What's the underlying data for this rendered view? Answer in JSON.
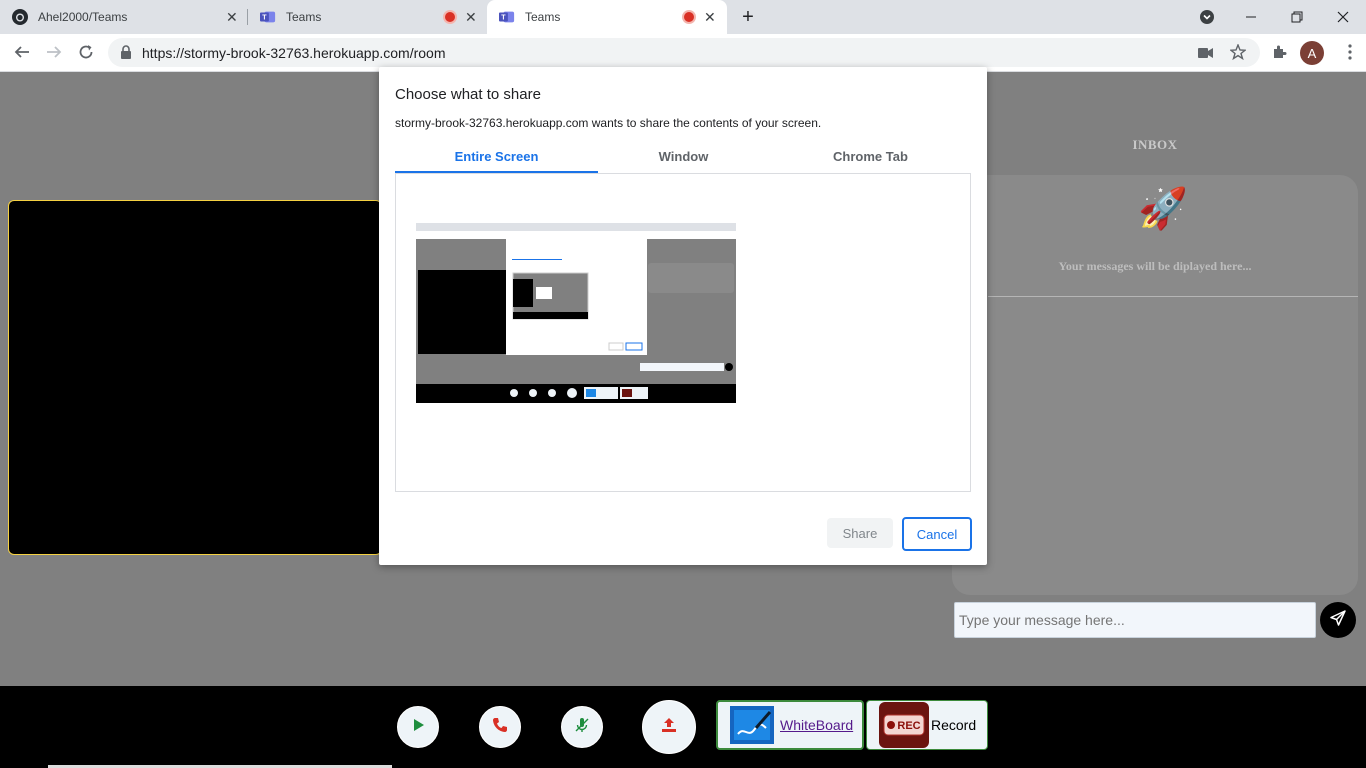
{
  "browser": {
    "tabs": [
      {
        "title": "Ahel2000/Teams",
        "icon": "github-icon"
      },
      {
        "title": "Teams",
        "icon": "teams-icon",
        "recording": true
      },
      {
        "title": "Teams",
        "icon": "teams-icon",
        "recording": true,
        "active": true
      }
    ],
    "url": "https://stormy-brook-32763.herokuapp.com/room",
    "profile_initial": "A"
  },
  "page": {
    "inbox_title": "INBOX",
    "inbox_empty_text": "Your messages will be diplayed here...",
    "message_placeholder": "Type your message here...",
    "controls": {
      "whiteboard_label": "WhiteBoard",
      "record_label": "Record",
      "rec_badge": "REC"
    }
  },
  "dialog": {
    "title": "Choose what to share",
    "subtitle": "stormy-brook-32763.herokuapp.com wants to share the contents of your screen.",
    "tabs": [
      "Entire Screen",
      "Window",
      "Chrome Tab"
    ],
    "selected_tab": "Entire Screen",
    "share_label": "Share",
    "cancel_label": "Cancel"
  },
  "colors": {
    "accent": "#1a73e8",
    "video_border": "#f5d142",
    "page_bg": "#808080",
    "record_red": "#d93025"
  }
}
